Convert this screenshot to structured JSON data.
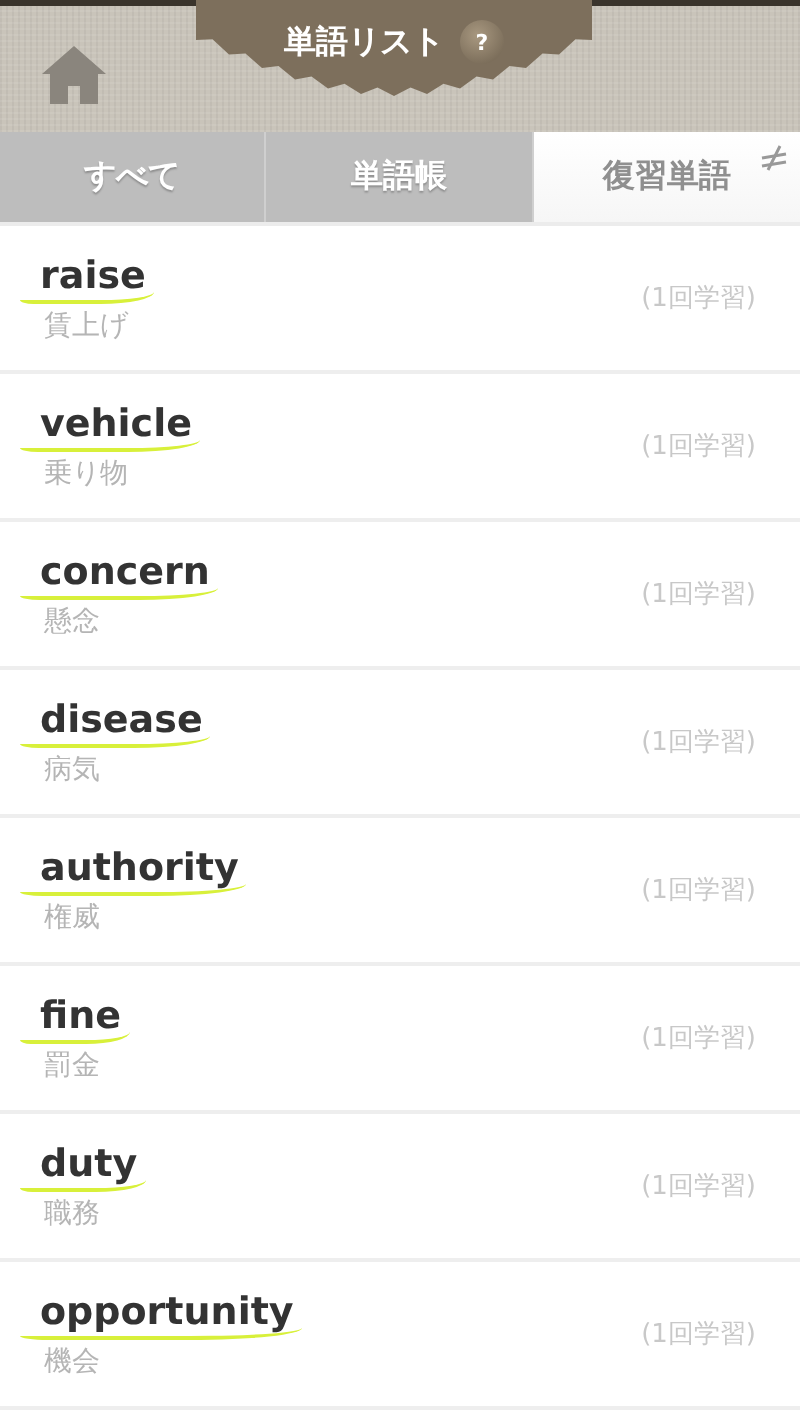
{
  "header": {
    "title": "単語リスト",
    "help": "?"
  },
  "tabs": [
    {
      "label": "すべて",
      "selected": false
    },
    {
      "label": "単語帳",
      "selected": false
    },
    {
      "label": "復習単語",
      "selected": true
    }
  ],
  "words": [
    {
      "word": "raise",
      "meaning": "賃上げ",
      "count": "(1回学習)"
    },
    {
      "word": "vehicle",
      "meaning": "乗り物",
      "count": "(1回学習)"
    },
    {
      "word": "concern",
      "meaning": "懸念",
      "count": "(1回学習)"
    },
    {
      "word": "disease",
      "meaning": "病気",
      "count": "(1回学習)"
    },
    {
      "word": "authority",
      "meaning": "権威",
      "count": "(1回学習)"
    },
    {
      "word": "fine",
      "meaning": "罰金",
      "count": "(1回学習)"
    },
    {
      "word": "duty",
      "meaning": "職務",
      "count": "(1回学習)"
    },
    {
      "word": "opportunity",
      "meaning": "機会",
      "count": "(1回学習)"
    }
  ]
}
